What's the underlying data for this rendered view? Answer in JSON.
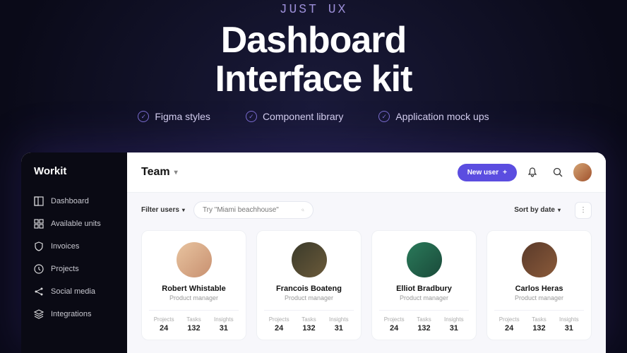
{
  "hero": {
    "brand": "JUST UX",
    "title_line1": "Dashboard",
    "title_line2": "Interface kit",
    "features": [
      "Figma styles",
      "Component library",
      "Application mock ups"
    ]
  },
  "sidebar": {
    "logo": "Workit",
    "items": [
      {
        "label": "Dashboard",
        "icon": "dashboard"
      },
      {
        "label": "Available units",
        "icon": "grid"
      },
      {
        "label": "Invoices",
        "icon": "shield"
      },
      {
        "label": "Projects",
        "icon": "clock"
      },
      {
        "label": "Social media",
        "icon": "share"
      },
      {
        "label": "Integrations",
        "icon": "layers"
      }
    ]
  },
  "topbar": {
    "title": "Team",
    "new_user_label": "New user",
    "plus": "+"
  },
  "filters": {
    "filter_label": "Filter users",
    "search_placeholder": "Try \"Miami beachhouse\"",
    "sort_label": "Sort by date"
  },
  "users": [
    {
      "name": "Robert Whistable",
      "role": "Product manager",
      "stats": {
        "projects": "24",
        "tasks": "132",
        "insights": "31"
      }
    },
    {
      "name": "Francois Boateng",
      "role": "Product manager",
      "stats": {
        "projects": "24",
        "tasks": "132",
        "insights": "31"
      }
    },
    {
      "name": "Elliot Bradbury",
      "role": "Product manager",
      "stats": {
        "projects": "24",
        "tasks": "132",
        "insights": "31"
      }
    },
    {
      "name": "Carlos Heras",
      "role": "Product manager",
      "stats": {
        "projects": "24",
        "tasks": "132",
        "insights": "31"
      }
    }
  ],
  "stat_labels": {
    "projects": "Projects",
    "tasks": "Tasks",
    "insights": "Insights"
  }
}
